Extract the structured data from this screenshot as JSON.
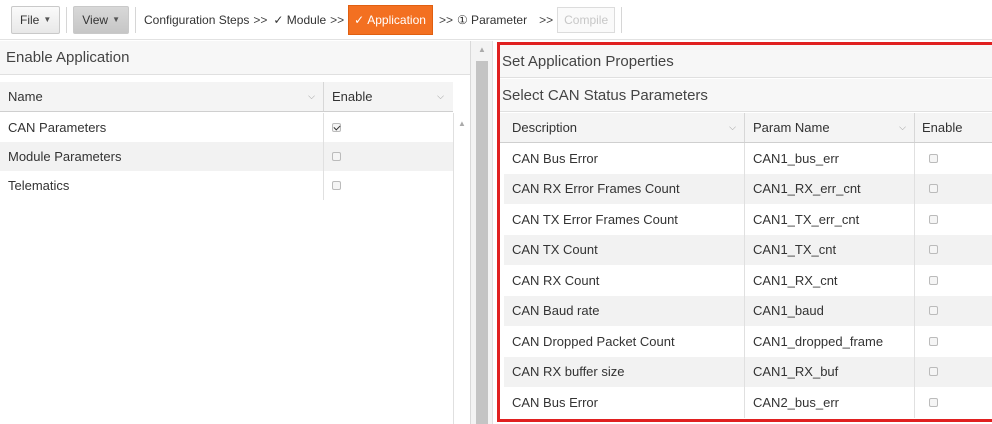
{
  "page_top_text": "pplicati",
  "toolbar": {
    "file_label": "File",
    "view_label": "View",
    "config_steps": "Configuration Steps",
    "arrow": ">>",
    "module_step": "✓ Module",
    "application_step": "Application",
    "parameter_step": "① Parameter",
    "compile_label": "Compile"
  },
  "left": {
    "title": "Enable Application",
    "columns": {
      "name": "Name",
      "enable": "Enable"
    },
    "rows": [
      {
        "name": "CAN Parameters",
        "enabled": true
      },
      {
        "name": "Module Parameters",
        "enabled": false
      },
      {
        "name": "Telematics",
        "enabled": false
      }
    ]
  },
  "right": {
    "title": "Set Application Properties",
    "subtitle": "Select CAN Status Parameters",
    "columns": {
      "description": "Description",
      "param_name": "Param Name",
      "enable": "Enable"
    },
    "rows": [
      {
        "description": "CAN Bus Error",
        "param": "CAN1_bus_err",
        "enabled": false
      },
      {
        "description": "CAN RX Error Frames Count",
        "param": "CAN1_RX_err_cnt",
        "enabled": false
      },
      {
        "description": "CAN TX Error Frames Count",
        "param": "CAN1_TX_err_cnt",
        "enabled": false
      },
      {
        "description": "CAN TX Count",
        "param": "CAN1_TX_cnt",
        "enabled": false
      },
      {
        "description": "CAN RX Count",
        "param": "CAN1_RX_cnt",
        "enabled": false
      },
      {
        "description": "CAN Baud rate",
        "param": "CAN1_baud",
        "enabled": false
      },
      {
        "description": "CAN Dropped Packet Count",
        "param": "CAN1_dropped_frame",
        "enabled": false
      },
      {
        "description": "CAN RX buffer size",
        "param": "CAN1_RX_buf",
        "enabled": false
      },
      {
        "description": "CAN Bus Error",
        "param": "CAN2_bus_err",
        "enabled": false
      }
    ]
  },
  "colors": {
    "accent": "#f37021",
    "highlight_border": "#e02020"
  }
}
